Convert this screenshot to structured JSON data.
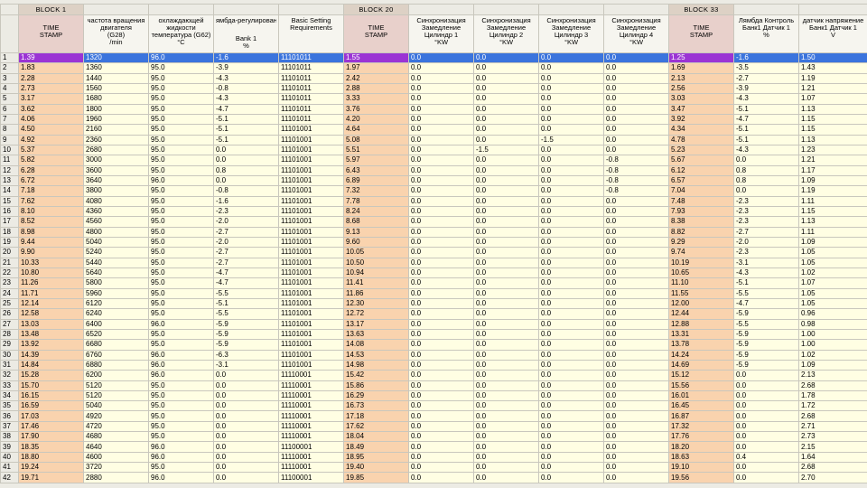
{
  "colors": {
    "chrome": "#ecebe4",
    "grid_line": "#c9c7bd",
    "block_bg": "#ddd1c5",
    "header_bg": "#f6f5ef",
    "timestamp_header_bg": "#e8d0cb",
    "cell_bg": "#fffee3",
    "timestamp_bg": "#f9d3ae",
    "selection_bg": "#3b74dd",
    "selection_timestamp_bg": "#9b34d4"
  },
  "blocks": [
    "BLOCK 1",
    "BLOCK 20",
    "BLOCK 33"
  ],
  "column_headers": [
    [
      "TIME",
      "STAMP"
    ],
    [
      "частота вращения",
      "двигателя",
      "(G28)",
      "/min"
    ],
    [
      "охлаждающей",
      "жидкости",
      "температура (G62)",
      "°C"
    ],
    [
      "ямбда-регулирован",
      "Bank 1",
      "%"
    ],
    [
      "Basic Setting",
      "Requirements"
    ],
    [
      "TIME",
      "STAMP"
    ],
    [
      "Синхронизация",
      "Замедление",
      "Цилиндр 1",
      "°KW"
    ],
    [
      "Синхронизация",
      "Замедление",
      "Цилиндр 2",
      "°KW"
    ],
    [
      "Синхронизация",
      "Замедление",
      "Цилиндр 3",
      "°KW"
    ],
    [
      "Синхронизация",
      "Замедление",
      "Цилиндр 4",
      "°KW"
    ],
    [
      "TIME",
      "STAMP"
    ],
    [
      "Лямбда Контроль",
      "Банк1 Датчик 1",
      "%"
    ],
    [
      "датчик напряжение",
      "Банк1 Датчик 1",
      "V"
    ]
  ],
  "selected_row": 1,
  "rows": [
    [
      "1",
      "1.39",
      "1320",
      "96.0",
      "-1.6",
      "11101011",
      "1.55",
      "0.0",
      "0.0",
      "0.0",
      "0.0",
      "1.25",
      "-1.6",
      "1.50"
    ],
    [
      "2",
      "1.83",
      "1360",
      "95.0",
      "-3.9",
      "11101011",
      "1.97",
      "0.0",
      "0.0",
      "0.0",
      "0.0",
      "1.69",
      "-3.5",
      "1.43"
    ],
    [
      "3",
      "2.28",
      "1440",
      "95.0",
      "-4.3",
      "11101011",
      "2.42",
      "0.0",
      "0.0",
      "0.0",
      "0.0",
      "2.13",
      "-2.7",
      "1.19"
    ],
    [
      "4",
      "2.73",
      "1560",
      "95.0",
      "-0.8",
      "11101011",
      "2.88",
      "0.0",
      "0.0",
      "0.0",
      "0.0",
      "2.56",
      "-3.9",
      "1.21"
    ],
    [
      "5",
      "3.17",
      "1680",
      "95.0",
      "-4.3",
      "11101011",
      "3.33",
      "0.0",
      "0.0",
      "0.0",
      "0.0",
      "3.03",
      "-4.3",
      "1.07"
    ],
    [
      "6",
      "3.62",
      "1800",
      "95.0",
      "-4.7",
      "11101011",
      "3.76",
      "0.0",
      "0.0",
      "0.0",
      "0.0",
      "3.47",
      "-5.1",
      "1.13"
    ],
    [
      "7",
      "4.06",
      "1960",
      "95.0",
      "-5.1",
      "11101011",
      "4.20",
      "0.0",
      "0.0",
      "0.0",
      "0.0",
      "3.92",
      "-4.7",
      "1.15"
    ],
    [
      "8",
      "4.50",
      "2160",
      "95.0",
      "-5.1",
      "11101001",
      "4.64",
      "0.0",
      "0.0",
      "0.0",
      "0.0",
      "4.34",
      "-5.1",
      "1.15"
    ],
    [
      "9",
      "4.92",
      "2360",
      "95.0",
      "-5.1",
      "11101001",
      "5.08",
      "0.0",
      "0.0",
      "-1.5",
      "0.0",
      "4.78",
      "-5.1",
      "1.13"
    ],
    [
      "10",
      "5.37",
      "2680",
      "95.0",
      "0.0",
      "11101001",
      "5.51",
      "0.0",
      "-1.5",
      "0.0",
      "0.0",
      "5.23",
      "-4.3",
      "1.23"
    ],
    [
      "11",
      "5.82",
      "3000",
      "95.0",
      "0.0",
      "11101001",
      "5.97",
      "0.0",
      "0.0",
      "0.0",
      "-0.8",
      "5.67",
      "0.0",
      "1.21"
    ],
    [
      "12",
      "6.28",
      "3600",
      "95.0",
      "0.8",
      "11101001",
      "6.43",
      "0.0",
      "0.0",
      "0.0",
      "-0.8",
      "6.12",
      "0.8",
      "1.17"
    ],
    [
      "13",
      "6.72",
      "3640",
      "96.0",
      "0.0",
      "11101001",
      "6.89",
      "0.0",
      "0.0",
      "0.0",
      "-0.8",
      "6.57",
      "0.8",
      "1.09"
    ],
    [
      "14",
      "7.18",
      "3800",
      "95.0",
      "-0.8",
      "11101001",
      "7.32",
      "0.0",
      "0.0",
      "0.0",
      "-0.8",
      "7.04",
      "0.0",
      "1.19"
    ],
    [
      "15",
      "7.62",
      "4080",
      "95.0",
      "-1.6",
      "11101001",
      "7.78",
      "0.0",
      "0.0",
      "0.0",
      "0.0",
      "7.48",
      "-2.3",
      "1.11"
    ],
    [
      "16",
      "8.10",
      "4360",
      "95.0",
      "-2.3",
      "11101001",
      "8.24",
      "0.0",
      "0.0",
      "0.0",
      "0.0",
      "7.93",
      "-2.3",
      "1.15"
    ],
    [
      "17",
      "8.52",
      "4560",
      "95.0",
      "-2.0",
      "11101001",
      "8.68",
      "0.0",
      "0.0",
      "0.0",
      "0.0",
      "8.38",
      "-2.3",
      "1.13"
    ],
    [
      "18",
      "8.98",
      "4800",
      "95.0",
      "-2.7",
      "11101001",
      "9.13",
      "0.0",
      "0.0",
      "0.0",
      "0.0",
      "8.82",
      "-2.7",
      "1.11"
    ],
    [
      "19",
      "9.44",
      "5040",
      "95.0",
      "-2.0",
      "11101001",
      "9.60",
      "0.0",
      "0.0",
      "0.0",
      "0.0",
      "9.29",
      "-2.0",
      "1.09"
    ],
    [
      "20",
      "9.90",
      "5240",
      "95.0",
      "-2.7",
      "11101001",
      "10.05",
      "0.0",
      "0.0",
      "0.0",
      "0.0",
      "9.74",
      "-2.3",
      "1.05"
    ],
    [
      "21",
      "10.33",
      "5440",
      "95.0",
      "-2.7",
      "11101001",
      "10.50",
      "0.0",
      "0.0",
      "0.0",
      "0.0",
      "10.19",
      "-3.1",
      "1.05"
    ],
    [
      "22",
      "10.80",
      "5640",
      "95.0",
      "-4.7",
      "11101001",
      "10.94",
      "0.0",
      "0.0",
      "0.0",
      "0.0",
      "10.65",
      "-4.3",
      "1.02"
    ],
    [
      "23",
      "11.26",
      "5800",
      "95.0",
      "-4.7",
      "11101001",
      "11.41",
      "0.0",
      "0.0",
      "0.0",
      "0.0",
      "11.10",
      "-5.1",
      "1.07"
    ],
    [
      "24",
      "11.71",
      "5960",
      "95.0",
      "-5.5",
      "11101001",
      "11.86",
      "0.0",
      "0.0",
      "0.0",
      "0.0",
      "11.55",
      "-5.5",
      "1.05"
    ],
    [
      "25",
      "12.14",
      "6120",
      "95.0",
      "-5.1",
      "11101001",
      "12.30",
      "0.0",
      "0.0",
      "0.0",
      "0.0",
      "12.00",
      "-4.7",
      "1.05"
    ],
    [
      "26",
      "12.58",
      "6240",
      "95.0",
      "-5.5",
      "11101001",
      "12.72",
      "0.0",
      "0.0",
      "0.0",
      "0.0",
      "12.44",
      "-5.9",
      "0.96"
    ],
    [
      "27",
      "13.03",
      "6400",
      "96.0",
      "-5.9",
      "11101001",
      "13.17",
      "0.0",
      "0.0",
      "0.0",
      "0.0",
      "12.88",
      "-5.5",
      "0.98"
    ],
    [
      "28",
      "13.48",
      "6520",
      "95.0",
      "-5.9",
      "11101001",
      "13.63",
      "0.0",
      "0.0",
      "0.0",
      "0.0",
      "13.31",
      "-5.9",
      "1.00"
    ],
    [
      "29",
      "13.92",
      "6680",
      "95.0",
      "-5.9",
      "11101001",
      "14.08",
      "0.0",
      "0.0",
      "0.0",
      "0.0",
      "13.78",
      "-5.9",
      "1.00"
    ],
    [
      "30",
      "14.39",
      "6760",
      "96.0",
      "-6.3",
      "11101001",
      "14.53",
      "0.0",
      "0.0",
      "0.0",
      "0.0",
      "14.24",
      "-5.9",
      "1.02"
    ],
    [
      "31",
      "14.84",
      "6880",
      "96.0",
      "-3.1",
      "11101001",
      "14.98",
      "0.0",
      "0.0",
      "0.0",
      "0.0",
      "14.69",
      "-5.9",
      "1.09"
    ],
    [
      "32",
      "15.28",
      "6200",
      "96.0",
      "0.0",
      "11110001",
      "15.42",
      "0.0",
      "0.0",
      "0.0",
      "0.0",
      "15.12",
      "0.0",
      "2.13"
    ],
    [
      "33",
      "15.70",
      "5120",
      "95.0",
      "0.0",
      "11110001",
      "15.86",
      "0.0",
      "0.0",
      "0.0",
      "0.0",
      "15.56",
      "0.0",
      "2.68"
    ],
    [
      "34",
      "16.15",
      "5120",
      "95.0",
      "0.0",
      "11110001",
      "16.29",
      "0.0",
      "0.0",
      "0.0",
      "0.0",
      "16.01",
      "0.0",
      "1.78"
    ],
    [
      "35",
      "16.59",
      "5040",
      "95.0",
      "0.0",
      "11110001",
      "16.73",
      "0.0",
      "0.0",
      "0.0",
      "0.0",
      "16.45",
      "0.0",
      "1.72"
    ],
    [
      "36",
      "17.03",
      "4920",
      "95.0",
      "0.0",
      "11110001",
      "17.18",
      "0.0",
      "0.0",
      "0.0",
      "0.0",
      "16.87",
      "0.0",
      "2.68"
    ],
    [
      "37",
      "17.46",
      "4720",
      "95.0",
      "0.0",
      "11110001",
      "17.62",
      "0.0",
      "0.0",
      "0.0",
      "0.0",
      "17.32",
      "0.0",
      "2.71"
    ],
    [
      "38",
      "17.90",
      "4680",
      "95.0",
      "0.0",
      "11110001",
      "18.04",
      "0.0",
      "0.0",
      "0.0",
      "0.0",
      "17.76",
      "0.0",
      "2.73"
    ],
    [
      "39",
      "18.35",
      "4640",
      "96.0",
      "0.0",
      "11100001",
      "18.49",
      "0.0",
      "0.0",
      "0.0",
      "0.0",
      "18.20",
      "0.0",
      "2.15"
    ],
    [
      "40",
      "18.80",
      "4600",
      "96.0",
      "0.0",
      "11110001",
      "18.95",
      "0.0",
      "0.0",
      "0.0",
      "0.0",
      "18.63",
      "0.4",
      "1.64"
    ],
    [
      "41",
      "19.24",
      "3720",
      "95.0",
      "0.0",
      "11110001",
      "19.40",
      "0.0",
      "0.0",
      "0.0",
      "0.0",
      "19.10",
      "0.0",
      "2.68"
    ],
    [
      "42",
      "19.71",
      "2880",
      "96.0",
      "0.0",
      "11100001",
      "19.85",
      "0.0",
      "0.0",
      "0.0",
      "0.0",
      "19.56",
      "0.0",
      "2.70"
    ]
  ]
}
